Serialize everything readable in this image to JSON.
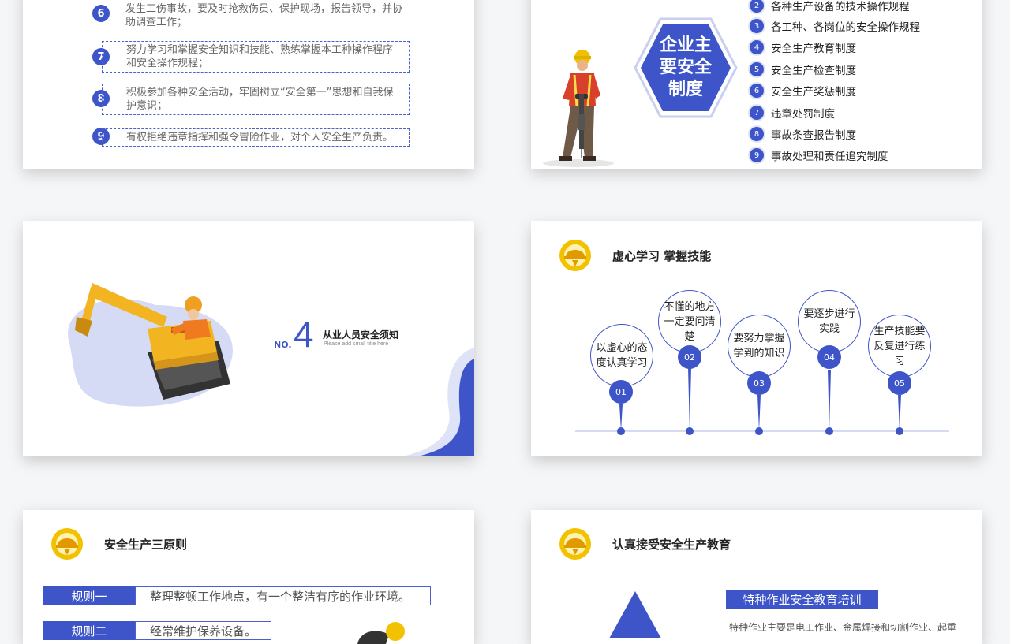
{
  "slide1": {
    "items": [
      {
        "num": "6",
        "text": "发生工伤事故，要及时抢救伤员、保护现场，报告领导，并协助调查工作；"
      },
      {
        "num": "7",
        "text": "努力学习和掌握安全知识和技能、熟练掌握本工种操作程序和安全操作规程；"
      },
      {
        "num": "8",
        "text": "积极参加各种安全活动，牢固树立“安全第一”思想和自我保护意识；"
      },
      {
        "num": "9",
        "text": "有权拒绝违章指挥和强令冒险作业，对个人安全生产负责。"
      }
    ]
  },
  "slide2": {
    "hex_line1": "企业主",
    "hex_line2": "要安全",
    "hex_line3": "制度",
    "items": [
      {
        "num": "2",
        "text": "各种生产设备的技术操作规程"
      },
      {
        "num": "3",
        "text": "各工种、各岗位的安全操作规程"
      },
      {
        "num": "4",
        "text": "安全生产教育制度"
      },
      {
        "num": "5",
        "text": "安全生产检查制度"
      },
      {
        "num": "6",
        "text": "安全生产奖惩制度"
      },
      {
        "num": "7",
        "text": "违章处罚制度"
      },
      {
        "num": "8",
        "text": "事故条查报告制度"
      },
      {
        "num": "9",
        "text": "事故处理和责任追究制度"
      }
    ]
  },
  "slide3": {
    "no_label": "NO.",
    "number": "4",
    "title": "从业人员安全须知",
    "subtitle": "Please add small title here"
  },
  "slide4": {
    "title": "虚心学习 掌握技能",
    "steps": [
      {
        "num": "01",
        "text": "以虚心的态度认真学习"
      },
      {
        "num": "02",
        "text": "不懂的地方一定要问清楚"
      },
      {
        "num": "03",
        "text": "要努力掌握学到的知识"
      },
      {
        "num": "04",
        "text": "要逐步进行实践"
      },
      {
        "num": "05",
        "text": "生产技能要反复进行练习"
      }
    ]
  },
  "slide5": {
    "title": "安全生产三原则",
    "rules": [
      {
        "label": "规则一",
        "text": "整理整顿工作地点，有一个整洁有序的作业环境。"
      },
      {
        "label": "规则二",
        "text": "经常维护保养设备。"
      }
    ]
  },
  "slide6": {
    "title": "认真接受安全生产教育",
    "badge": "特种作业安全教育培训",
    "para": "特种作业主要是电工作业、金属焊接和切割作业、起重"
  },
  "colors": {
    "accent": "#3e55c9",
    "light_accent": "#dfe3f7",
    "gold": "#f2c200"
  }
}
